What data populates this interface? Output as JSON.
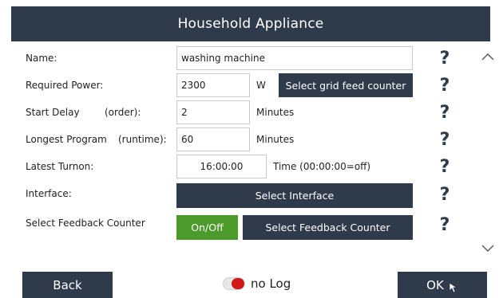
{
  "dialog": {
    "title": "Household Appliance"
  },
  "rows": {
    "name": {
      "label": "Name:",
      "value": "washing machine"
    },
    "power": {
      "label": "Required Power:",
      "value": "2300",
      "unit": "W",
      "button": "Select grid feed counter"
    },
    "delay": {
      "label": "Start Delay",
      "sublabel": "(order):",
      "value": "2",
      "unit": "Minutes"
    },
    "program": {
      "label": "Longest Program",
      "sublabel": "(runtime):",
      "value": "60",
      "unit": "Minutes"
    },
    "turnon": {
      "label": "Latest Turnon:",
      "value": "16:00:00",
      "hint": "Time (00:00:00=off)"
    },
    "interface": {
      "label": "Interface:",
      "button": "Select Interface"
    },
    "feedback": {
      "label": "Select Feedback Counter",
      "toggle_button": "On/Off",
      "button": "Select Feedback Counter"
    }
  },
  "help_glyph": "?",
  "footer": {
    "back": "Back",
    "log_label": "no Log",
    "ok": "OK"
  },
  "colors": {
    "dark": "#2f3a4a",
    "green": "#4c9a2a",
    "toggle_red": "#d01818"
  }
}
